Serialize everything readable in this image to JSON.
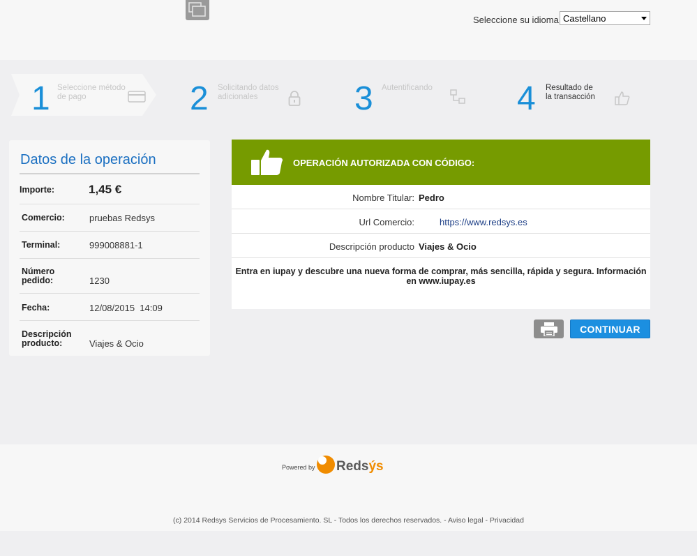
{
  "header": {
    "language_label": "Seleccione su idioma",
    "language_selected": "Castellano"
  },
  "steps": [
    {
      "number": "1",
      "label": "Seleccione método de pago",
      "icon": "credit-card-icon",
      "active": true
    },
    {
      "number": "2",
      "label": "Solicitando datos adicionales",
      "icon": "lock-icon",
      "active": false
    },
    {
      "number": "3",
      "label": "Autentificando",
      "icon": "authentication-icon",
      "active": false
    },
    {
      "number": "4",
      "label": "Resultado de la transacción",
      "icon": "thumbs-up-icon",
      "active": true
    }
  ],
  "operation": {
    "title": "Datos de la operación",
    "amount_label": "Importe:",
    "amount": "1,45 €",
    "merchant_label": "Comercio:",
    "merchant": "pruebas Redsys",
    "terminal_label": "Terminal:",
    "terminal": "999008881-1",
    "order_label": "Número pedido:",
    "order": "1230",
    "date_label": "Fecha:",
    "date": "12/08/2015  14:09",
    "product_label": "Descripción producto:",
    "product": "Viajes & Ocio"
  },
  "result": {
    "heading": "OPERACIÓN AUTORIZADA CON CÓDIGO:",
    "holder_label": "Nombre Titular:",
    "holder": "Pedro",
    "url_label": "Url Comercio:",
    "url": "https://www.redsys.es",
    "desc_label": "Descripción producto",
    "desc": "Viajes & Ocio",
    "promo": "Entra en iupay y descubre una nueva forma de comprar, más sencilla, rápida y segura. Información en www.iupay.es"
  },
  "actions": {
    "continue_label": "CONTINUAR",
    "print_icon": "printer-icon"
  },
  "footer": {
    "powered_by": "Powered by",
    "brand_main": "Reds",
    "brand_accent": "ýs",
    "copyright": "(c) 2014 Redsys Servicios de Procesamiento. SL - Todos los derechos reservados.",
    "legal": "Aviso legal",
    "privacy": "Privacidad"
  },
  "colors": {
    "accent_blue": "#1a8fd8",
    "success_green": "#769b00",
    "brand_orange": "#f08c00"
  }
}
